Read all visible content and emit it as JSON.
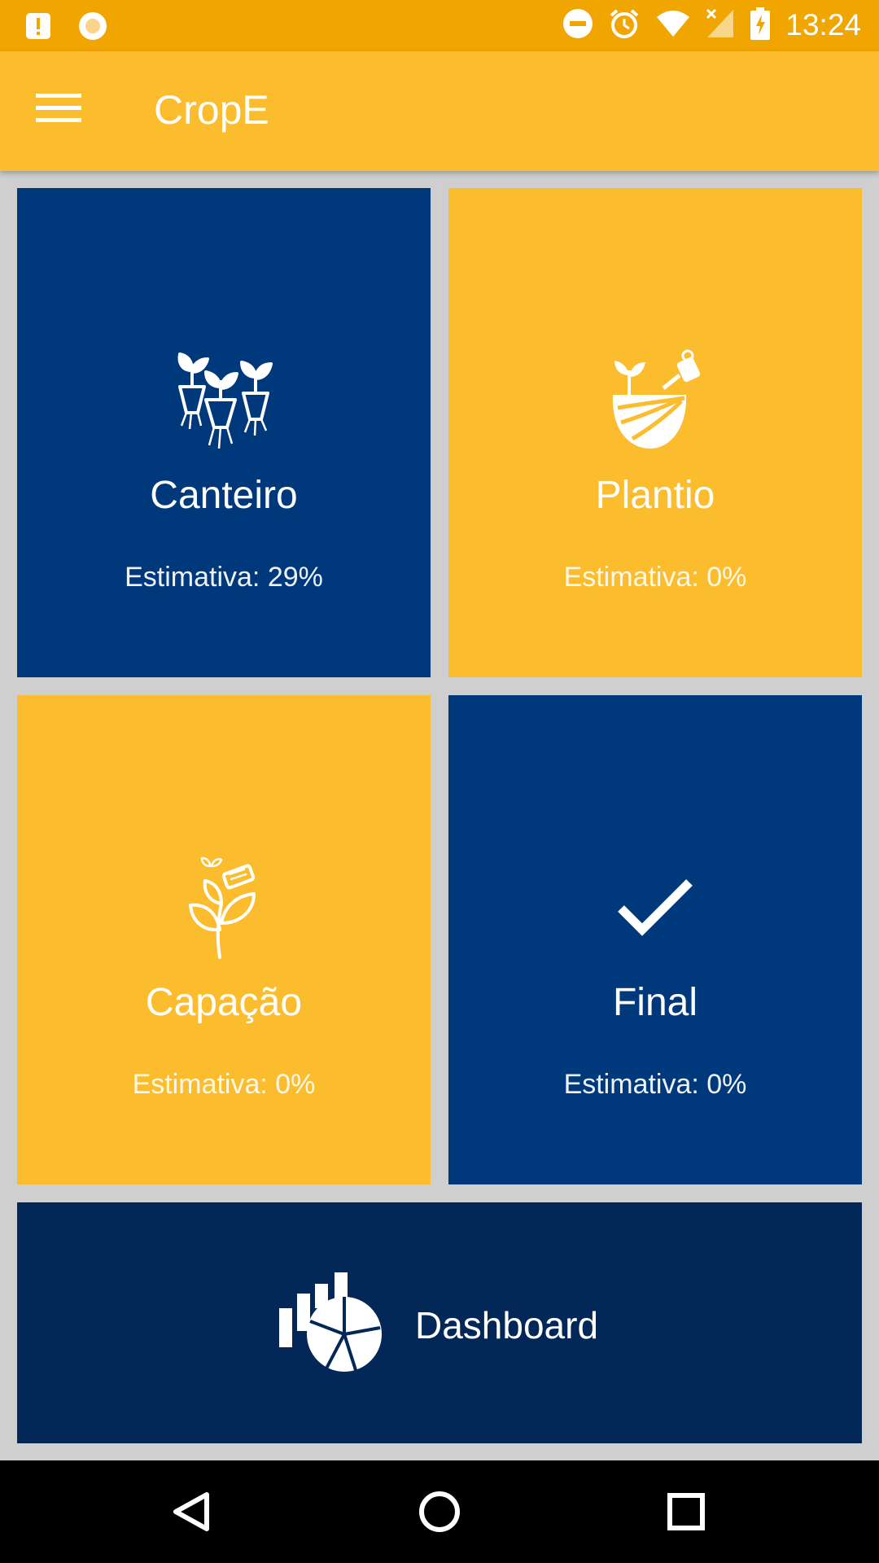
{
  "status_bar": {
    "time": "13:24",
    "left_icons": [
      "alert-notification-icon",
      "record-icon"
    ],
    "right_icons": [
      "do-not-disturb-icon",
      "alarm-icon",
      "wifi-icon",
      "signal-icon",
      "battery-charging-icon"
    ]
  },
  "toolbar": {
    "title": "CropE",
    "menu_icon": "hamburger-menu-icon"
  },
  "tiles": [
    {
      "title": "Canteiro",
      "estimate": "Estimativa: 29%",
      "icon": "seedlings-icon",
      "color": "#00387c"
    },
    {
      "title": "Plantio",
      "estimate": "Estimativa: 0%",
      "icon": "field-watering-icon",
      "color": "#fbbc2e"
    },
    {
      "title": "Capação",
      "estimate": "Estimativa: 0%",
      "icon": "plant-scissors-icon",
      "color": "#fbbc2e"
    },
    {
      "title": "Final",
      "estimate": "Estimativa: 0%",
      "icon": "checkmark-icon",
      "color": "#00387c"
    }
  ],
  "dashboard": {
    "label": "Dashboard",
    "icon": "bar-pie-chart-icon",
    "color": "#032858"
  },
  "nav_bar": {
    "buttons": [
      "back-icon",
      "home-icon",
      "recents-icon"
    ]
  },
  "colors": {
    "status_bar": "#f0a500",
    "toolbar": "#fbbc2e",
    "background": "#cfcfcf"
  }
}
